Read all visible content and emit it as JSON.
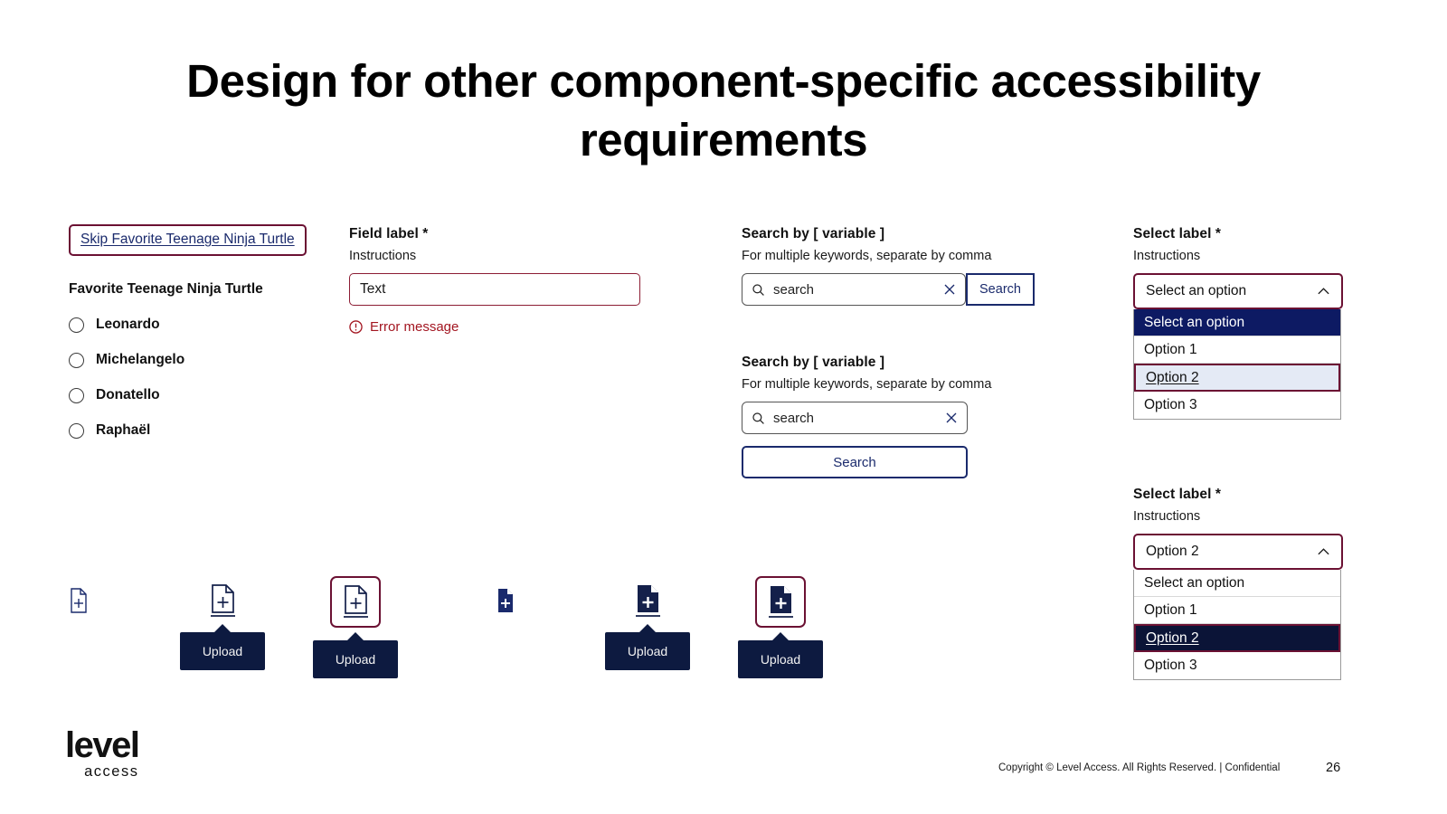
{
  "slide": {
    "title": "Design for other component-specific accessibility requirements",
    "page_number": "26",
    "copyright": "Copyright © Level Access. All Rights Reserved. | Confidential",
    "logo": {
      "word": "level",
      "sub": "access"
    },
    "colors": {
      "focus_ring": "#6b1133",
      "error": "#a31621",
      "navy": "#1a2a6c",
      "tooltip_bg": "#0d1a40",
      "option_selected": "#0d1a63"
    }
  },
  "skip_link_group": {
    "skip_link": "Skip Favorite Teenage Ninja Turtle",
    "group_label": "Favorite Teenage Ninja Turtle",
    "radios": [
      {
        "label": "Leonardo",
        "checked": false
      },
      {
        "label": "Michelangelo",
        "checked": false
      },
      {
        "label": "Donatello",
        "checked": false
      },
      {
        "label": "Raphaël",
        "checked": false
      }
    ]
  },
  "text_field": {
    "label": "Field label *",
    "instructions": "Instructions",
    "value": "Text",
    "error_message": "Error message",
    "error_icon": "alert-circle-icon"
  },
  "search_inline": {
    "label": "Search by [ variable ]",
    "instructions": "For multiple keywords, separate by comma",
    "placeholder": "search",
    "clear_icon": "close-icon",
    "search_icon": "search-icon",
    "button_label": "Search"
  },
  "search_stacked": {
    "label": "Search by [ variable ]",
    "instructions": "For multiple keywords, separate by comma",
    "placeholder": "search",
    "clear_icon": "close-icon",
    "search_icon": "search-icon",
    "button_label": "Search"
  },
  "select_first": {
    "label": "Select label *",
    "instructions": "Instructions",
    "value": "Select an option",
    "chevron_icon": "chevron-up-icon",
    "options": [
      {
        "label": "Select an option",
        "state": "selected-navy"
      },
      {
        "label": "Option 1",
        "state": "normal"
      },
      {
        "label": "Option 2",
        "state": "focus-ring"
      },
      {
        "label": "Option 3",
        "state": "normal"
      }
    ]
  },
  "select_second": {
    "label": "Select label *",
    "instructions": "Instructions",
    "value": "Option 2",
    "chevron_icon": "chevron-up-icon",
    "options": [
      {
        "label": "Select an option",
        "state": "normal"
      },
      {
        "label": "Option 1",
        "state": "normal"
      },
      {
        "label": "Option 2",
        "state": "selected-dark-focus"
      },
      {
        "label": "Option 3",
        "state": "normal"
      }
    ]
  },
  "uploads": [
    {
      "icon": "file-add-icon",
      "style": "outline",
      "size": "small",
      "focused": false,
      "tooltip": null
    },
    {
      "icon": "file-add-icon",
      "style": "outline",
      "size": "large",
      "focused": false,
      "tooltip": "Upload"
    },
    {
      "icon": "file-add-icon",
      "style": "outline",
      "size": "large",
      "focused": true,
      "tooltip": "Upload"
    },
    {
      "icon": "file-add-icon",
      "style": "filled",
      "size": "small",
      "focused": false,
      "tooltip": null
    },
    {
      "icon": "file-add-icon",
      "style": "filled",
      "size": "large",
      "focused": false,
      "tooltip": "Upload"
    },
    {
      "icon": "file-add-icon",
      "style": "filled",
      "size": "large",
      "focused": true,
      "tooltip": "Upload"
    }
  ]
}
